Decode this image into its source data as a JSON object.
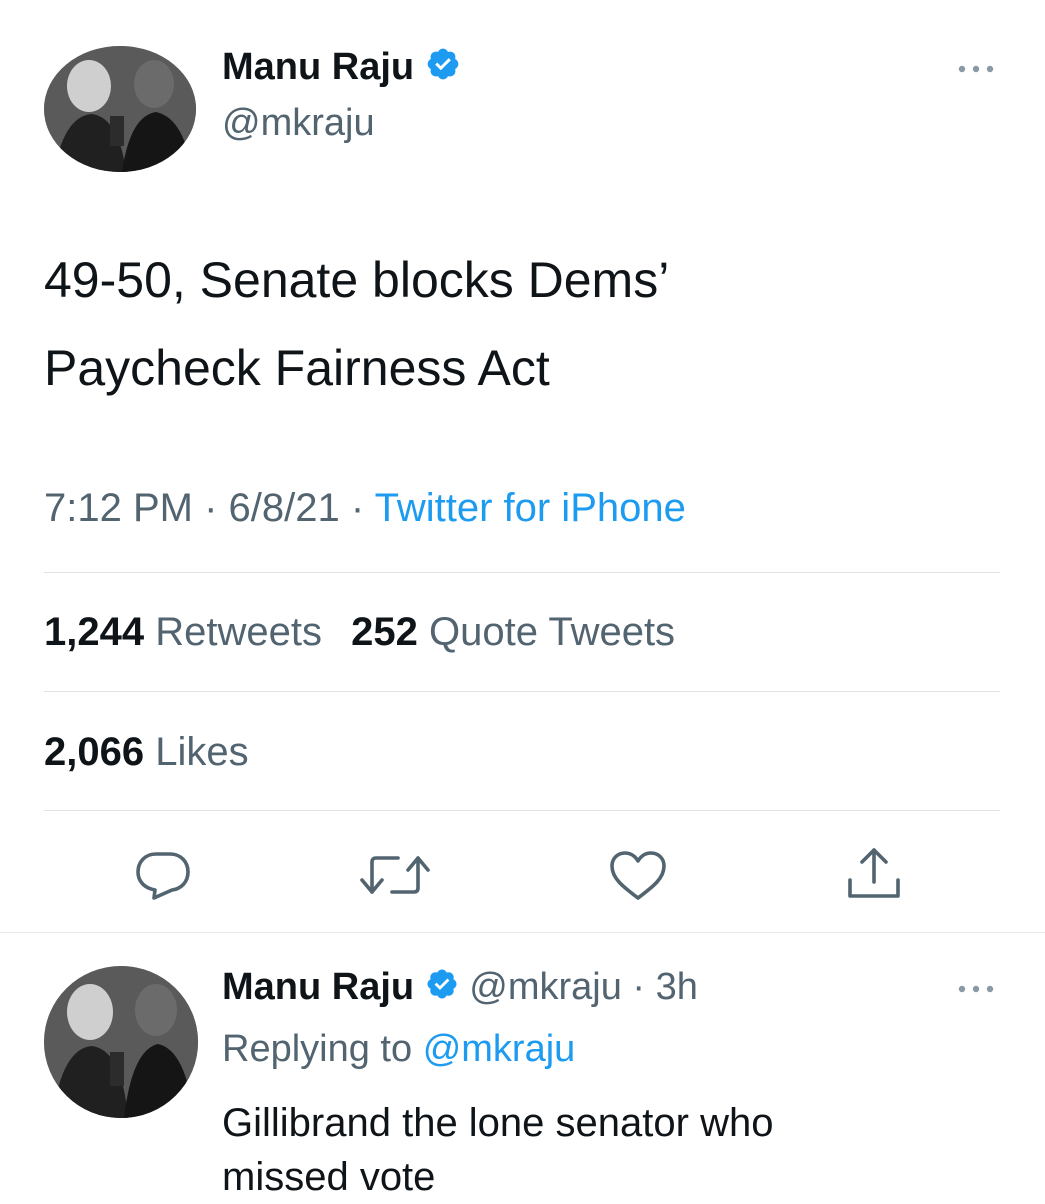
{
  "tweet": {
    "author": {
      "name": "Manu Raju",
      "handle": "@mkraju",
      "verified": true
    },
    "more_icon": "more-dots-icon",
    "text_line1": "49-50, Senate blocks Dems’",
    "text_line2": "Paycheck Fairness Act",
    "time": "7:12 PM",
    "date": "6/8/21",
    "separator": "·",
    "source": "Twitter for iPhone",
    "stats": {
      "retweets_count": "1,244",
      "retweets_label": "Retweets",
      "quotes_count": "252",
      "quotes_label": "Quote Tweets",
      "likes_count": "2,066",
      "likes_label": "Likes"
    },
    "actions": [
      "reply-icon",
      "retweet-icon",
      "like-icon",
      "share-icon"
    ]
  },
  "reply": {
    "author": {
      "name": "Manu Raju",
      "handle": "@mkraju",
      "verified": true
    },
    "separator": "·",
    "age": "3h",
    "replying_prefix": "Replying to",
    "replying_to": "@mkraju",
    "text_line1": "Gillibrand the lone senator who",
    "text_line2": "missed vote"
  },
  "colors": {
    "link": "#1d9bf0",
    "muted": "#536471",
    "text": "#0f1419",
    "divider": "#e1e4e6"
  }
}
